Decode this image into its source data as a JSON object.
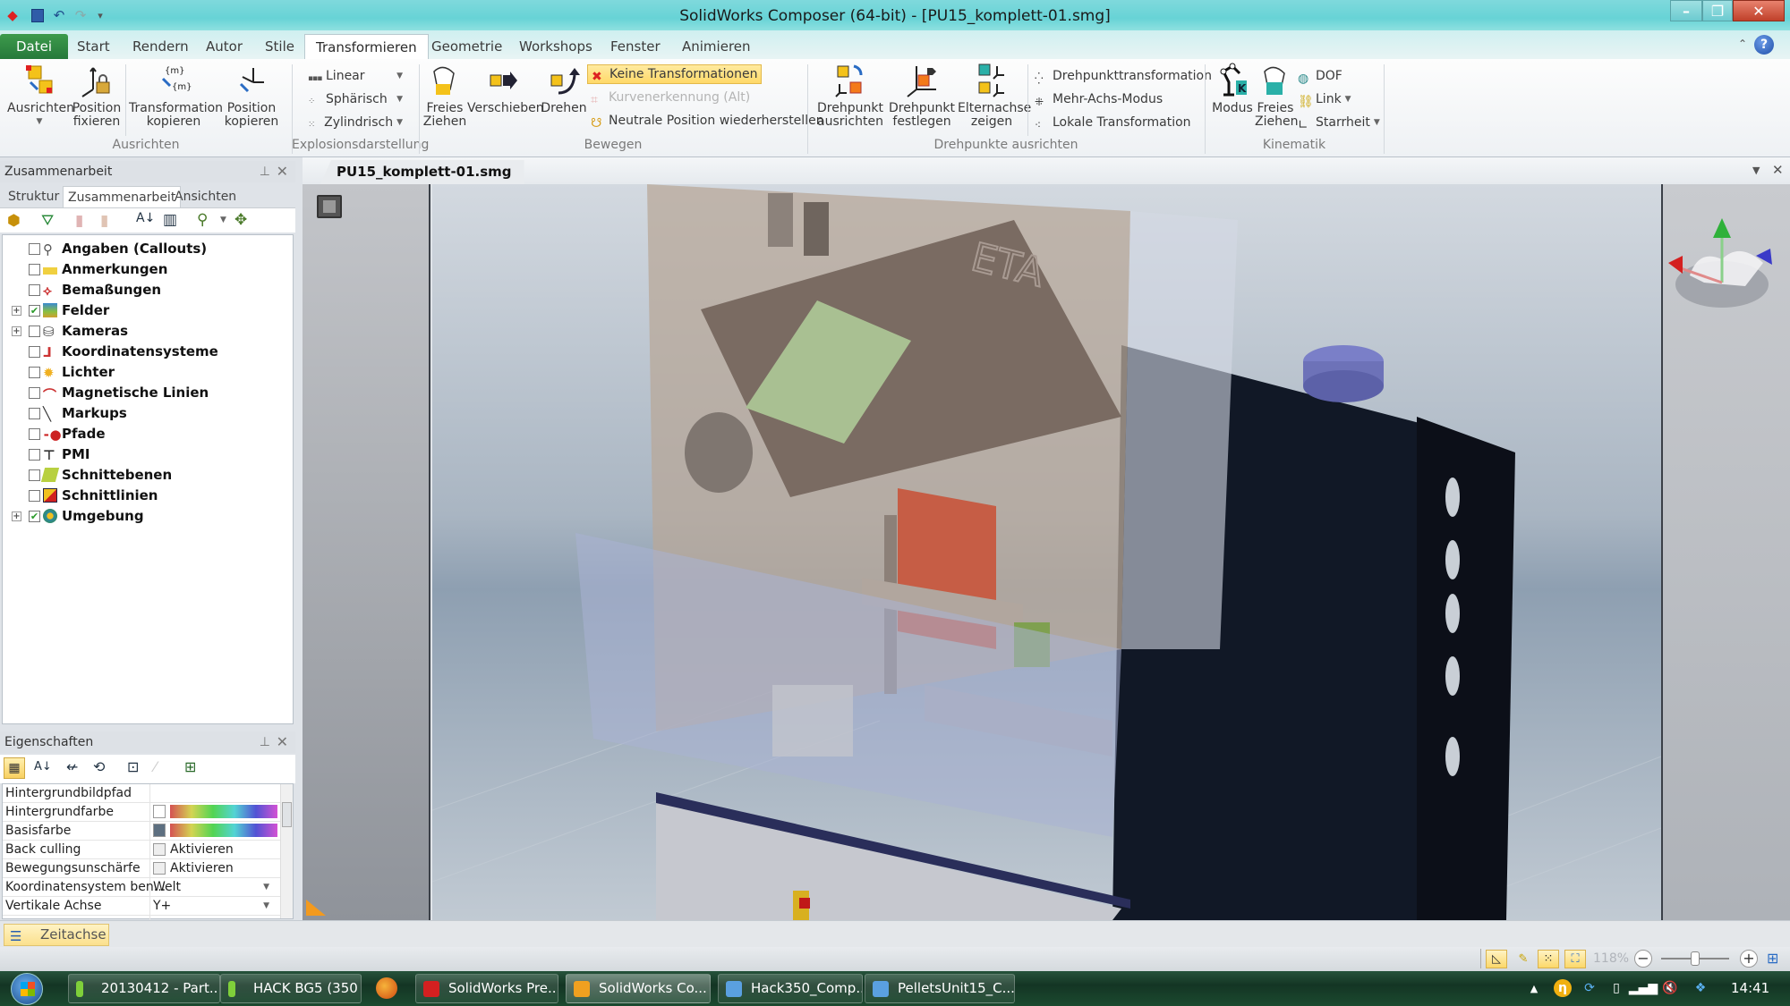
{
  "window": {
    "title": "SolidWorks Composer (64-bit) - [PU15_komplett-01.smg]",
    "controls": {
      "minimize": "–",
      "restore": "❐",
      "close": "✕"
    }
  },
  "quick_access": [
    "app-icon",
    "save-icon",
    "undo-icon",
    "redo-icon",
    "customize-icon"
  ],
  "ribbon_tabs": [
    {
      "label": "Datei"
    },
    {
      "label": "Start"
    },
    {
      "label": "Rendern"
    },
    {
      "label": "Autor"
    },
    {
      "label": "Stile"
    },
    {
      "label": "Transformieren",
      "active": true
    },
    {
      "label": "Geometrie"
    },
    {
      "label": "Workshops"
    },
    {
      "label": "Fenster"
    },
    {
      "label": "Animieren"
    }
  ],
  "ribbon": {
    "groups": {
      "ausrichten": {
        "label": "Ausrichten",
        "buttons": [
          {
            "label": "Ausrichten",
            "icon": "align-icon",
            "has_dropdown": true
          },
          {
            "label": "Position fixieren",
            "icon": "lock-position-icon"
          },
          {
            "label": "Transformation kopieren",
            "icon": "copy-transform-icon",
            "has_dropdown": true
          },
          {
            "label": "Position kopieren",
            "icon": "copy-position-icon",
            "has_dropdown": true
          }
        ]
      },
      "explosion": {
        "label": "Explosionsdarstellung",
        "buttons": [
          {
            "label": "Linear",
            "icon": "linear-explode-icon"
          },
          {
            "label": "Sphärisch",
            "icon": "spherical-explode-icon"
          },
          {
            "label": "Zylindrisch",
            "icon": "cylindrical-explode-icon"
          }
        ]
      },
      "bewegen": {
        "label": "Bewegen",
        "buttons": [
          {
            "label": "Freies Ziehen",
            "icon": "free-drag-icon"
          },
          {
            "label": "Verschieben",
            "icon": "translate-icon"
          },
          {
            "label": "Drehen",
            "icon": "rotate-icon"
          }
        ],
        "small": [
          {
            "label": "Keine Transformationen",
            "icon": "no-transform-icon",
            "state": "selected"
          },
          {
            "label": "Kurvenerkennung (Alt)",
            "icon": "curve-detection-icon",
            "state": "disabled"
          },
          {
            "label": "Neutrale Position wiederherstellen",
            "icon": "restore-neutral-icon"
          }
        ]
      },
      "drehpunkte": {
        "label": "Drehpunkte ausrichten",
        "buttons": [
          {
            "label": "Drehpunkt ausrichten",
            "icon": "align-pivot-icon",
            "has_dropdown": true
          },
          {
            "label": "Drehpunkt festlegen",
            "icon": "set-pivot-icon",
            "has_dropdown": true
          },
          {
            "label": "Elternachse zeigen",
            "icon": "parent-axis-icon"
          }
        ],
        "small": [
          {
            "label": "Drehpunkttransformation",
            "icon": "pivot-transform-icon"
          },
          {
            "label": "Mehr-Achs-Modus",
            "icon": "multi-axis-icon"
          },
          {
            "label": "Lokale Transformation",
            "icon": "local-transform-icon"
          }
        ]
      },
      "kinematik": {
        "label": "Kinematik",
        "buttons": [
          {
            "label": "Modus",
            "icon": "kinematic-mode-icon"
          },
          {
            "label": "Freies Ziehen",
            "icon": "kinematic-drag-icon"
          }
        ],
        "small": [
          {
            "label": "DOF",
            "icon": "dof-icon"
          },
          {
            "label": "Link",
            "icon": "link-icon",
            "has_dropdown": true
          },
          {
            "label": "Starrheit",
            "icon": "rigidity-icon",
            "has_dropdown": true
          }
        ]
      }
    }
  },
  "collab_panel": {
    "title": "Zusammenarbeit",
    "tabs": [
      {
        "label": "Struktur"
      },
      {
        "label": "Zusammenarbeit",
        "active": true
      },
      {
        "label": "Ansichten"
      }
    ],
    "toolbar": [
      "actor-icon",
      "filter-icon",
      "add-disabled-icon",
      "remove-disabled-icon",
      "sort-az-icon",
      "columns-icon",
      "search-actor-icon",
      "actor-options-icon"
    ],
    "tree": [
      {
        "label": "Angaben (Callouts)",
        "checked": false,
        "expandable": false,
        "icon": "callout-icon"
      },
      {
        "label": "Anmerkungen",
        "checked": false,
        "expandable": false,
        "icon": "annotation-icon"
      },
      {
        "label": "Bemaßungen",
        "checked": false,
        "expandable": false,
        "icon": "dimension-icon"
      },
      {
        "label": "Felder",
        "checked": true,
        "expandable": true,
        "icon": "field-icon"
      },
      {
        "label": "Kameras",
        "checked": false,
        "expandable": true,
        "icon": "camera-icon"
      },
      {
        "label": "Koordinatensysteme",
        "checked": false,
        "expandable": false,
        "icon": "coordinate-system-icon"
      },
      {
        "label": "Lichter",
        "checked": false,
        "expandable": false,
        "icon": "light-icon"
      },
      {
        "label": "Magnetische Linien",
        "checked": false,
        "expandable": false,
        "icon": "magnetic-line-icon"
      },
      {
        "label": "Markups",
        "checked": false,
        "expandable": false,
        "icon": "markup-icon"
      },
      {
        "label": "Pfade",
        "checked": false,
        "expandable": false,
        "icon": "path-icon"
      },
      {
        "label": "PMI",
        "checked": false,
        "expandable": false,
        "icon": "pmi-icon"
      },
      {
        "label": "Schnittebenen",
        "checked": false,
        "expandable": false,
        "icon": "section-plane-icon"
      },
      {
        "label": "Schnittlinien",
        "checked": false,
        "expandable": false,
        "icon": "section-line-icon"
      },
      {
        "label": "Umgebung",
        "checked": true,
        "expandable": true,
        "icon": "environment-icon"
      }
    ]
  },
  "props_panel": {
    "title": "Eigenschaften",
    "rows": [
      {
        "name": "Hintergrundbildpfad",
        "value": ""
      },
      {
        "name": "Hintergrundfarbe",
        "value": "",
        "swatch": "#ffffff"
      },
      {
        "name": "Basisfarbe",
        "value": "",
        "swatch": "#5d6f80"
      },
      {
        "name": "Back culling",
        "value": "Aktivieren",
        "checkbox": false
      },
      {
        "name": "Bewegungsunschärfe",
        "value": "Aktivieren",
        "checkbox": false
      },
      {
        "name": "Koordinatensystem ben...",
        "value": "Welt",
        "dropdown": true
      },
      {
        "name": "Vertikale Achse",
        "value": "Y+",
        "dropdown": true
      }
    ]
  },
  "document": {
    "tab_label": "PU15_komplett-01.smg",
    "brand_text": "ETA"
  },
  "timeline": {
    "label": "Zeitachse"
  },
  "status": {
    "zoom_label": "118%",
    "zoom_slider_fraction": 0.5
  },
  "taskbar": {
    "items": [
      {
        "label": "20130412 - Part...",
        "icon_color": "#7fcf3a"
      },
      {
        "label": "HACK BG5 (350 ...",
        "icon_color": "#7fcf3a"
      },
      {
        "label": "",
        "icon_color": "#e8731a",
        "icon": "firefox-icon"
      },
      {
        "label": "SolidWorks Pre...",
        "icon_color": "#d42020"
      },
      {
        "label": "SolidWorks Co...",
        "icon_color": "#f0a020",
        "active": true
      },
      {
        "label": "Hack350_Comp...",
        "icon_color": "#5aa0e0"
      },
      {
        "label": "PelletsUnit15_C...",
        "icon_color": "#5aa0e0"
      }
    ],
    "clock": "14:41"
  }
}
